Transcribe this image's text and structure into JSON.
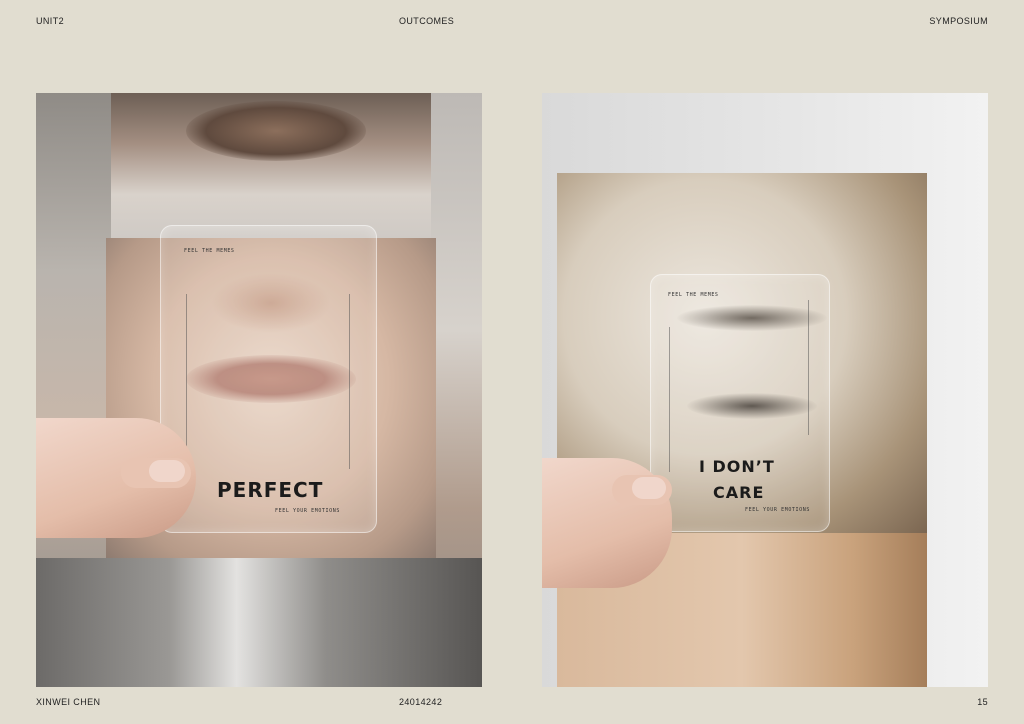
{
  "header": {
    "left": "UNIT2",
    "center": "OUTCOMES",
    "right": "SYMPOSIUM"
  },
  "footer": {
    "left": "XINWEI CHEN",
    "center": "24014242",
    "right": "15"
  },
  "cards": [
    {
      "top_text": "FEEL THE MEMES",
      "word": "PERFECT",
      "bottom_text": "FEEL YOUR EMOTIONS"
    },
    {
      "top_text": "FEEL THE MEMES",
      "word_line1": "I DON’T",
      "word_line2": "CARE",
      "bottom_text": "FEEL YOUR EMOTIONS"
    }
  ]
}
